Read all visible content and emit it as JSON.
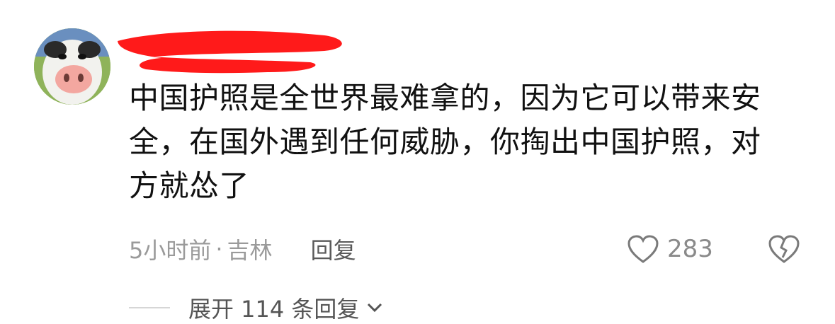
{
  "comment": {
    "avatar_icon": "cartoon-cow-avatar",
    "username_redacted": true,
    "lines": [
      "中国护照是全世界最难拿的，因为它可以带来安",
      "全，在国外遇到任何威胁，你掏出中国护照，对",
      "方就怂了"
    ],
    "time": "5小时前",
    "separator": "·",
    "location": "吉林",
    "reply_label": "回复",
    "like_icon": "heart-outline-icon",
    "like_count": "283",
    "dislike_icon": "broken-heart-icon",
    "expand_label": "展开 114 条回复",
    "expand_icon": "chevron-down-icon"
  },
  "colors": {
    "redaction": "#ff1a1a",
    "text": "#111111",
    "meta": "#9a9a9a"
  }
}
